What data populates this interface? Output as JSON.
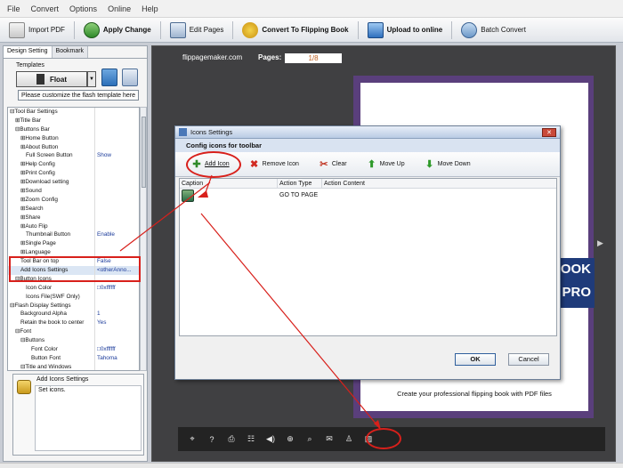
{
  "menu": [
    "File",
    "Convert",
    "Options",
    "Online",
    "Help"
  ],
  "toolbar": {
    "import_pdf": "Import PDF",
    "apply_change": "Apply Change",
    "edit_pages": "Edit Pages",
    "convert_flipping": "Convert To Flipping Book",
    "upload_online": "Upload to online",
    "batch_convert": "Batch Convert"
  },
  "left": {
    "tabs": [
      "Design Setting",
      "Bookmark"
    ],
    "templates_label": "Templates",
    "template_value": "Float",
    "customize_text": "Please customize the flash template here",
    "settings": [
      {
        "name": "⊟Tool Bar Settings",
        "value": "",
        "indent": 0
      },
      {
        "name": "⊞Title Bar",
        "value": "",
        "indent": 1
      },
      {
        "name": "⊟Buttons Bar",
        "value": "",
        "indent": 1
      },
      {
        "name": "⊞Home Button",
        "value": "",
        "indent": 2
      },
      {
        "name": "⊞About Button",
        "value": "",
        "indent": 2
      },
      {
        "name": "Full Screen Button",
        "value": "Show",
        "indent": 3
      },
      {
        "name": "⊞Help Config",
        "value": "",
        "indent": 2
      },
      {
        "name": "⊞Print Config",
        "value": "",
        "indent": 2
      },
      {
        "name": "⊞Download setting",
        "value": "",
        "indent": 2
      },
      {
        "name": "⊞Sound",
        "value": "",
        "indent": 2
      },
      {
        "name": "⊞Zoom Config",
        "value": "",
        "indent": 2
      },
      {
        "name": "⊞Search",
        "value": "",
        "indent": 2
      },
      {
        "name": "⊞Share",
        "value": "",
        "indent": 2
      },
      {
        "name": "⊞Auto Flip",
        "value": "",
        "indent": 2
      },
      {
        "name": "Thumbnail Button",
        "value": "Enable",
        "indent": 3
      },
      {
        "name": "⊞Single Page",
        "value": "",
        "indent": 2
      },
      {
        "name": "⊞Language",
        "value": "",
        "indent": 2
      },
      {
        "name": "Tool Bar on top",
        "value": "False",
        "indent": 2
      },
      {
        "name": "Add Icons Settings",
        "value": "<otherAnno...",
        "indent": 2
      },
      {
        "name": "⊟Button Icons",
        "value": "",
        "indent": 1
      },
      {
        "name": "Icon Color",
        "value": "□0xffffff",
        "indent": 3
      },
      {
        "name": "Icons File(SWF Only)",
        "value": "",
        "indent": 3
      },
      {
        "name": "⊟Flash Display Settings",
        "value": "",
        "indent": 0
      },
      {
        "name": "Background Alpha",
        "value": "1",
        "indent": 2
      },
      {
        "name": "Retain the book to center",
        "value": "Yes",
        "indent": 2
      },
      {
        "name": "⊟Font",
        "value": "",
        "indent": 1
      },
      {
        "name": "⊟Buttons",
        "value": "",
        "indent": 2
      },
      {
        "name": "Font Color",
        "value": "□0xffffff",
        "indent": 4
      },
      {
        "name": "Button Font",
        "value": "Tahoma",
        "indent": 4
      },
      {
        "name": "⊟Title and Windows",
        "value": "",
        "indent": 2
      }
    ],
    "desc_title": "Add Icons Settings",
    "desc_text": "Set icons."
  },
  "preview": {
    "site": "flippagemaker.com",
    "pages_label": "Pages:",
    "pages_value": "1/8",
    "book_band": "OOK\nPRO",
    "caption": "Create your professional flipping book with PDF files",
    "bottom_icons": [
      "⌖",
      "?",
      "⎙",
      "☷",
      "◀)",
      "⊕",
      "⌕",
      "✉",
      "♙",
      "▨"
    ]
  },
  "dialog": {
    "title": "Icons Settings",
    "subtitle": "Config icons for toolbar",
    "buttons": {
      "add": "Add Icon",
      "remove": "Remove Icon",
      "clear": "Clear",
      "move_up": "Move Up",
      "move_down": "Move Down"
    },
    "columns": [
      "Caption",
      "Action Type",
      "Action Content"
    ],
    "rows": [
      {
        "caption": "",
        "action_type": "GO TO PAGE",
        "action_content": ""
      }
    ],
    "ok": "OK",
    "cancel": "Cancel"
  },
  "colors": {
    "accent": "#d8201b",
    "book_frame": "#5a3f7c"
  }
}
